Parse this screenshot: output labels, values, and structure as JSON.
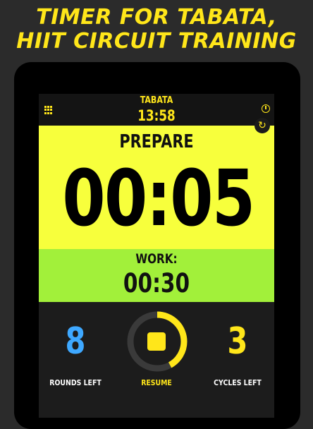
{
  "headline": {
    "line1": "TIMER FOR TABATA,",
    "line2": "HIIT CIRCUIT TRAINING"
  },
  "topbar": {
    "program": "TABATA",
    "clock": "13:58"
  },
  "phase": {
    "label": "PREPARE",
    "countdown": "00:05"
  },
  "next": {
    "label": "WORK:",
    "time": "00:30"
  },
  "stats": {
    "rounds_value": "8",
    "rounds_label": "ROUNDS LEFT",
    "resume_label": "RESUME",
    "cycles_value": "3",
    "cycles_label": "CYCLES LEFT"
  },
  "progress_fraction": 0.42,
  "colors": {
    "accent": "#ffe61a",
    "phase_bg": "#f7ff3c",
    "next_bg": "#a2f03a",
    "rounds": "#3ea8ff"
  }
}
